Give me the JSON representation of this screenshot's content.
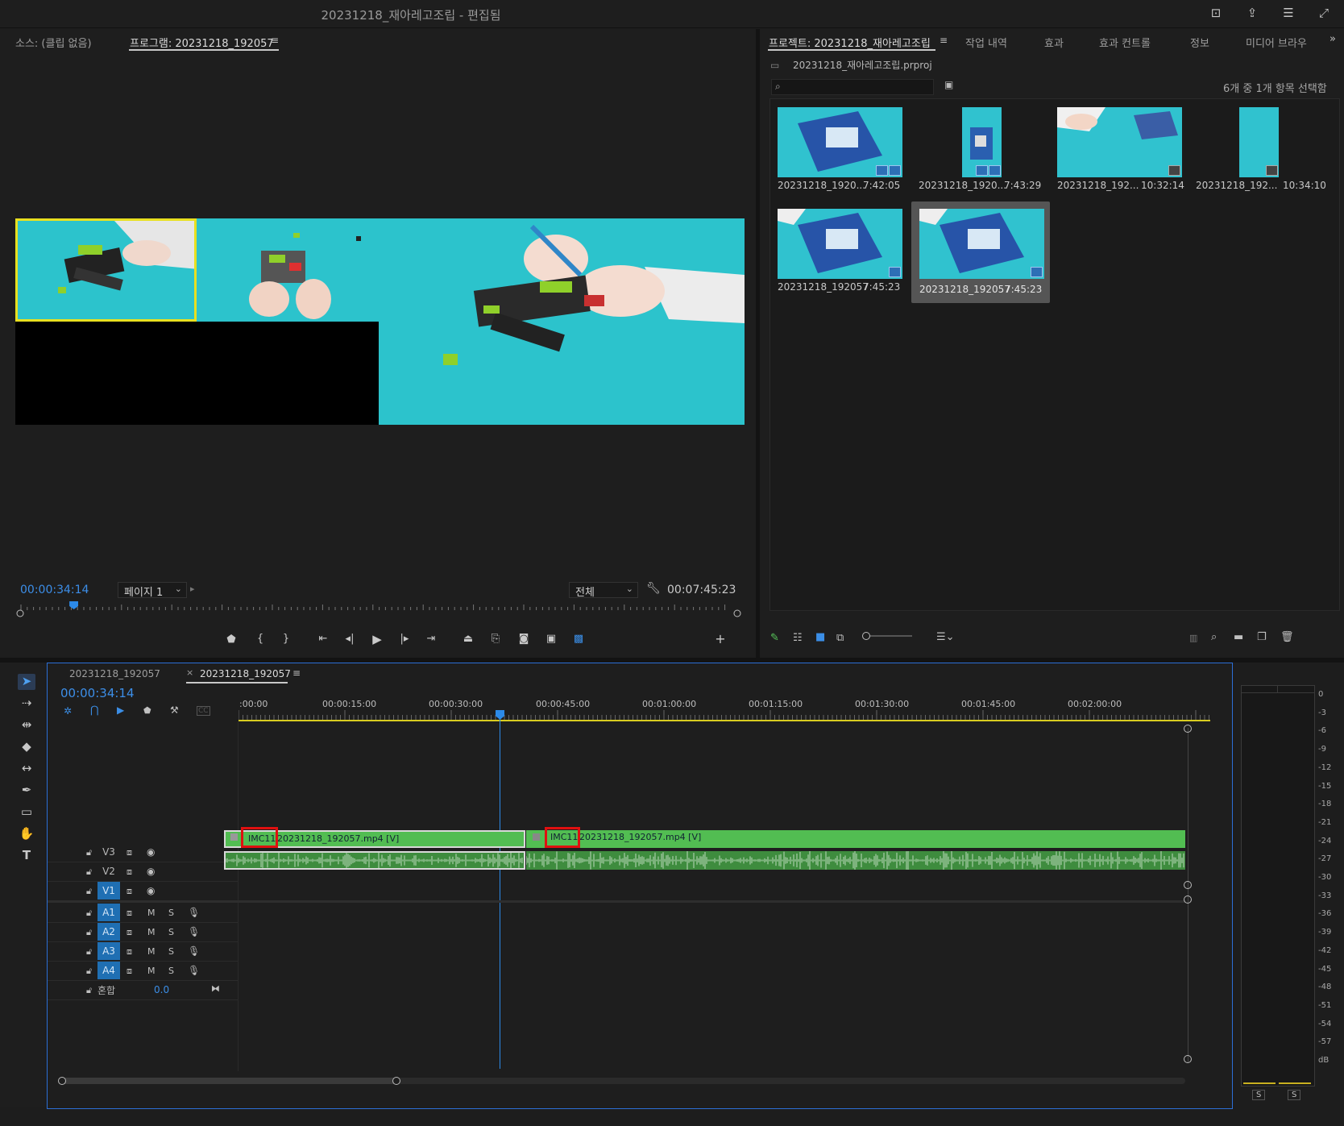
{
  "window": {
    "title": "20231218_재아레고조립 - 편집됨"
  },
  "monitor": {
    "source_tab": "소스: (클립 없음)",
    "program_tab": "프로그램: 20231218_192057",
    "current_timecode": "00:00:34:14",
    "page_select": "페이지 1",
    "zoom_select": "전체",
    "duration": "00:07:45:23",
    "playhead_fraction": 0.074
  },
  "project": {
    "tabs": [
      "프로젝트: 20231218_재아레고조립",
      "작업 내역",
      "효과",
      "효과 컨트롤",
      "정보",
      "미디어 브라우"
    ],
    "file": "20231218_재아레고조립.prproj",
    "search_placeholder": "",
    "selection_status": "6개 중 1개 항목 선택함",
    "items": [
      {
        "name": "20231218_1920...",
        "duration": "7:42:05"
      },
      {
        "name": "20231218_1920...",
        "duration": "7:43:29"
      },
      {
        "name": "20231218_192...",
        "duration": "10:32:14"
      },
      {
        "name": "20231218_192...",
        "duration": "10:34:10"
      },
      {
        "name": "20231218_192057",
        "duration": "7:45:23"
      },
      {
        "name": "20231218_192057",
        "duration": "7:45:23"
      }
    ]
  },
  "timeline": {
    "tabs": [
      "20231218_192057",
      "20231218_192057"
    ],
    "timecode": "00:00:34:14",
    "ruler": [
      ":00:00",
      "00:00:15:00",
      "00:00:30:00",
      "00:00:45:00",
      "00:01:00:00",
      "00:01:15:00",
      "00:01:30:00",
      "00:01:45:00",
      "00:02:00:00"
    ],
    "video_tracks": [
      "V3",
      "V2",
      "V1"
    ],
    "audio_tracks": [
      "A1",
      "A2",
      "A3",
      "A4"
    ],
    "mix_label": "혼합",
    "mix_value": "0.0",
    "clips": [
      {
        "label": "IMC11",
        "text": "20231218_192057.mp4 [V]"
      },
      {
        "label": "IMC11",
        "text": "20231218_192057.mp4 [V]"
      }
    ],
    "track_buttons": {
      "mute": "M",
      "solo": "S"
    }
  },
  "meters": {
    "scale": [
      "0",
      "-3",
      "-6",
      "-9",
      "-12",
      "-15",
      "-18",
      "-21",
      "-24",
      "-27",
      "-30",
      "-33",
      "-36",
      "-39",
      "-42",
      "-45",
      "-48",
      "-51",
      "-54",
      "-57",
      "dB"
    ],
    "solo_buttons": [
      "S",
      "S"
    ]
  },
  "colors": {
    "accent": "#2c8ae8",
    "clip_green": "#4fba4f",
    "selection": "#e8e020",
    "highlight_red": "#e01010"
  }
}
